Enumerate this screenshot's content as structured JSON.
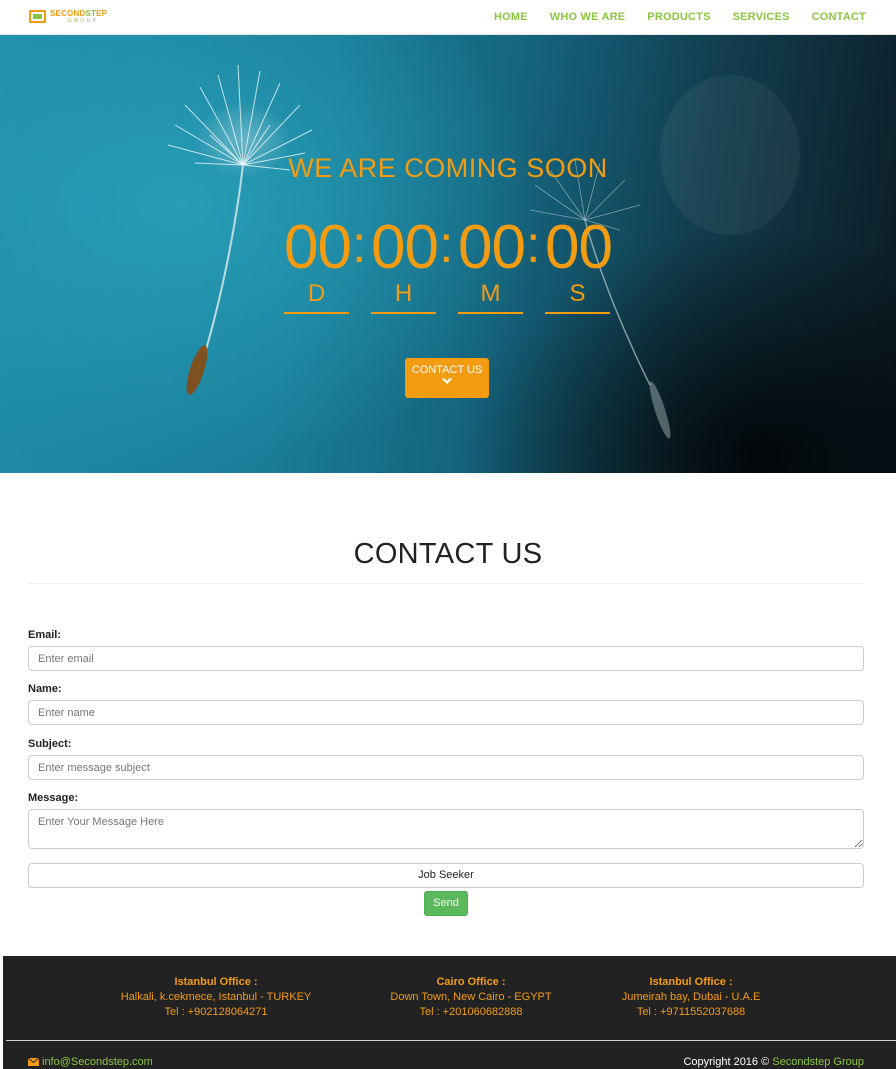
{
  "brand": {
    "name_a": "SECOND",
    "name_b": "ST",
    "name_c": "EP",
    "sub": "GROUP"
  },
  "nav": {
    "items": [
      "HOME",
      "WHO WE ARE",
      "PRODUCTS",
      "SERVICES",
      "CONTACT"
    ]
  },
  "hero": {
    "title": "WE ARE COMING SOON",
    "countdown": [
      {
        "value": "00",
        "unit": "D"
      },
      {
        "value": "00",
        "unit": "H"
      },
      {
        "value": "00",
        "unit": "M"
      },
      {
        "value": "00",
        "unit": "S"
      }
    ],
    "separator": ":",
    "cta_label": "CONTACT US"
  },
  "contact": {
    "title": "CONTACT US",
    "email_label": "Email:",
    "email_placeholder": "Enter email",
    "name_label": "Name:",
    "name_placeholder": "Enter name",
    "subject_label": "Subject:",
    "subject_placeholder": "Enter message subject",
    "message_label": "Message:",
    "message_placeholder": "Enter Your Message Here",
    "type_selected": "Job Seeker",
    "send_label": "Send"
  },
  "footer": {
    "offices": [
      {
        "title": "Istanbul Office :",
        "address": "Halkali, k.cekmece, Istanbul - TURKEY",
        "tel": "Tel : +902128064271"
      },
      {
        "title": "Cairo Office :",
        "address": "Down Town, New Cairo - EGYPT",
        "tel": "Tel : +201060682888"
      },
      {
        "title": "Istanbul Office :",
        "address": "Jumeirah bay, Dubai - U.A.E",
        "tel": "Tel : +9711552037688"
      }
    ],
    "email": "info@Secondstep.com",
    "copyright": "Copyright 2016 ©",
    "copyright_brand": "Secondstep Group"
  },
  "colors": {
    "accent": "#f39c12",
    "brand_green": "#8cc63f",
    "send_green": "#5cb85c",
    "footer_bg": "#222222"
  },
  "icons": {
    "cta": "chevron-down-icon",
    "email": "envelope-icon"
  }
}
